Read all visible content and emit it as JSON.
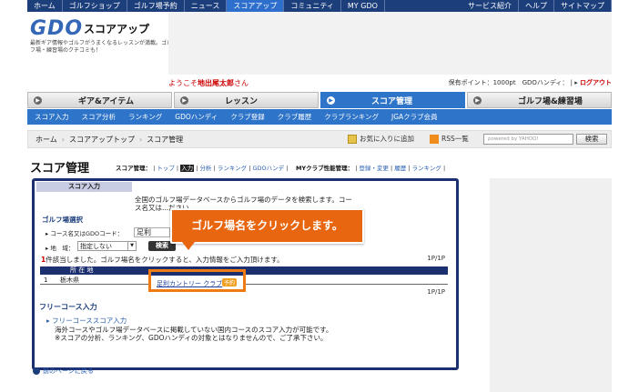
{
  "topnav": {
    "left": [
      "ホーム",
      "ゴルフショップ",
      "ゴルフ場予約",
      "ニュース",
      "スコアアップ",
      "コミュニティ",
      "MY GDO"
    ],
    "right": [
      "サービス紹介",
      "ヘルプ",
      "サイトマップ"
    ]
  },
  "logo": {
    "brand": "GDO",
    "sub": "スコアアップ",
    "tagline": "最新ギア情報やゴルフがうまくなるレッスンが満載。ゴルフ場・練習場のクチコミも！"
  },
  "header": {
    "welcome_prefix": "ようこそ",
    "user": "地出尾太郎",
    "welcome_suffix": "さん",
    "points": "保有ポイント：1000pt",
    "handicap": "GDOハンディ：",
    "logout": "ログアウト"
  },
  "tabs": [
    "ギア&アイテム",
    "レッスン",
    "スコア管理",
    "ゴルフ場&練習場"
  ],
  "subnav": [
    "スコア入力",
    "スコア分析",
    "ランキング",
    "GDOハンディ",
    "クラブ登録",
    "クラブ履歴",
    "クラブランキング",
    "JGAクラブ会員"
  ],
  "breadcrumb": {
    "home": "ホーム",
    "parent": "スコアアップトップ",
    "current": "スコア管理"
  },
  "utility": {
    "favorite": "お気に入りに追加",
    "rss": "RSS一覧",
    "search_placeholder": "powered by YAHOO!",
    "search_button": "検索"
  },
  "page": {
    "title": "スコア管理",
    "scorenav_label": "スコア管理：",
    "scorenav": [
      "トップ",
      "入力",
      "分析",
      "ランキング",
      "GDOハンデ"
    ],
    "myclub_label": "MYクラブ性能管理：",
    "myclub": [
      "登録・変更",
      "履歴",
      "ランキング"
    ]
  },
  "panel": {
    "title": "スコア入力",
    "db_text": "全国のゴルフ場データベースからゴルフ場のデータを検索します。コース名又は...ださい。",
    "select_heading": "ゴルフ場選択",
    "course_label": "コース名又はGDOコード：",
    "course_value": "足利",
    "region_label": "地　域：",
    "region_value": "指定しない",
    "search_button": "検索",
    "found_count": "1",
    "found_text": "件該当しました。ゴルフ場名をクリックすると、入力情報をご入力頂けます。",
    "page_indicator": "1P/1P",
    "col_location": "所 在 地",
    "row_no": "1",
    "row_pref": "栃木県",
    "course_link": "足利カントリー クラブ",
    "course_tag": "予約",
    "free_heading": "フリーコース入力",
    "free_link": "フリーコーススコア入力",
    "free_text1": "海外コースやゴルフ場データベースに掲載していない国内コースのスコア入力が可能です。",
    "free_text2": "※スコアの分析、ランキング、GDOハンディの対象とはなりませんので、ご了承下さい。"
  },
  "back_link": "前のページに戻る",
  "callout": "ゴルフ場名をクリックします。"
}
